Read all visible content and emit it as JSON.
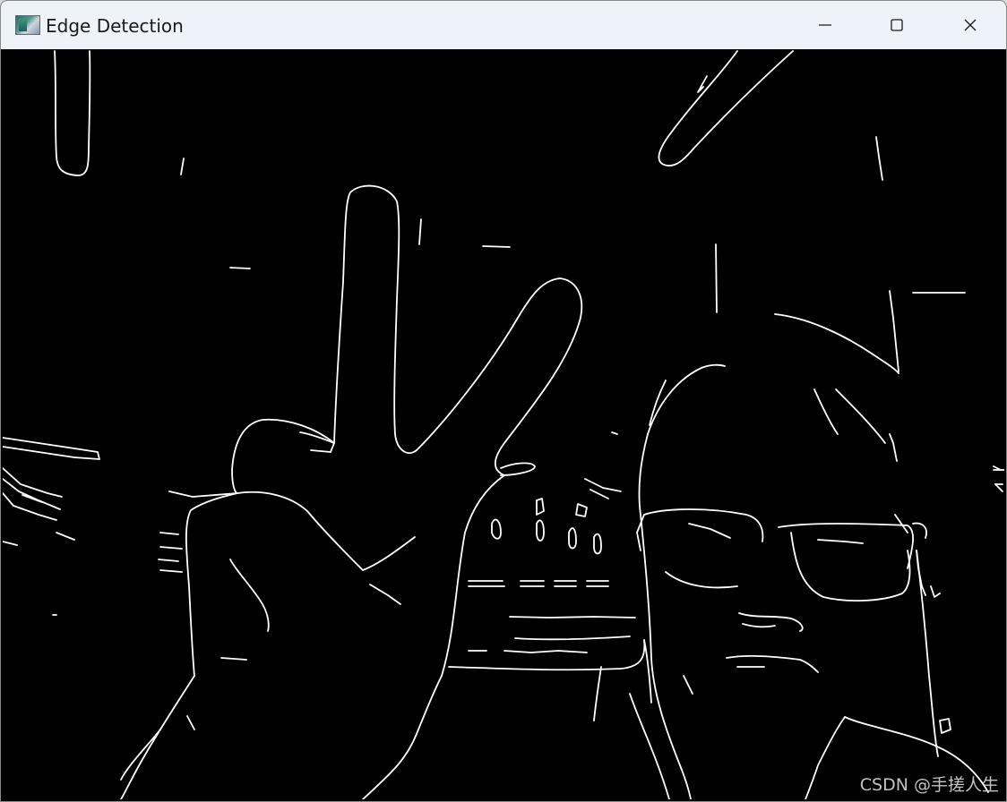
{
  "window": {
    "title": "Edge Detection",
    "icon": "opencv-image-window-icon",
    "controls": {
      "minimize": "minimize-icon",
      "maximize": "maximize-icon",
      "close": "close-icon"
    }
  },
  "canvas": {
    "background": "#000000",
    "edge_color": "#ffffff"
  },
  "watermark": {
    "text": "CSDN @手搓人生"
  }
}
